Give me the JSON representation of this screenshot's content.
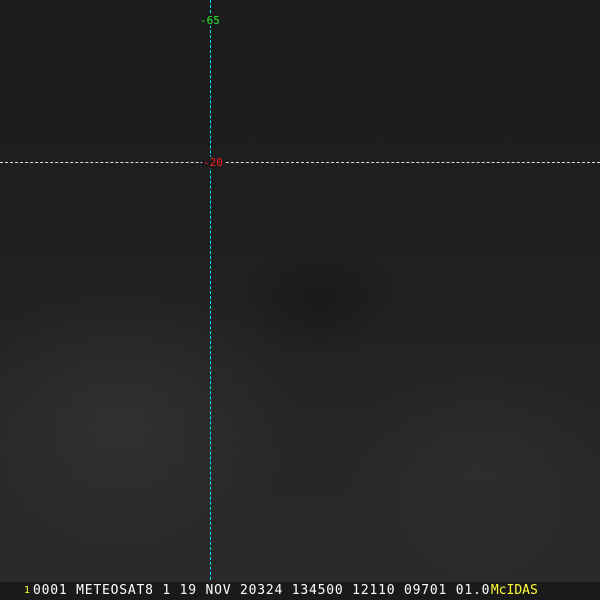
{
  "overlay": {
    "longitude_label": "-65",
    "latitude_label": "-20",
    "line_color": "#00e5ff",
    "longitude_label_color": "#22ee22",
    "latitude_label_color": "#ff2020"
  },
  "info_bar": {
    "frame_number": "1",
    "text": "0001 METEOSAT8    1 19 NOV 20324 134500 12110 09701 01.00",
    "brand": "McIDAS"
  }
}
